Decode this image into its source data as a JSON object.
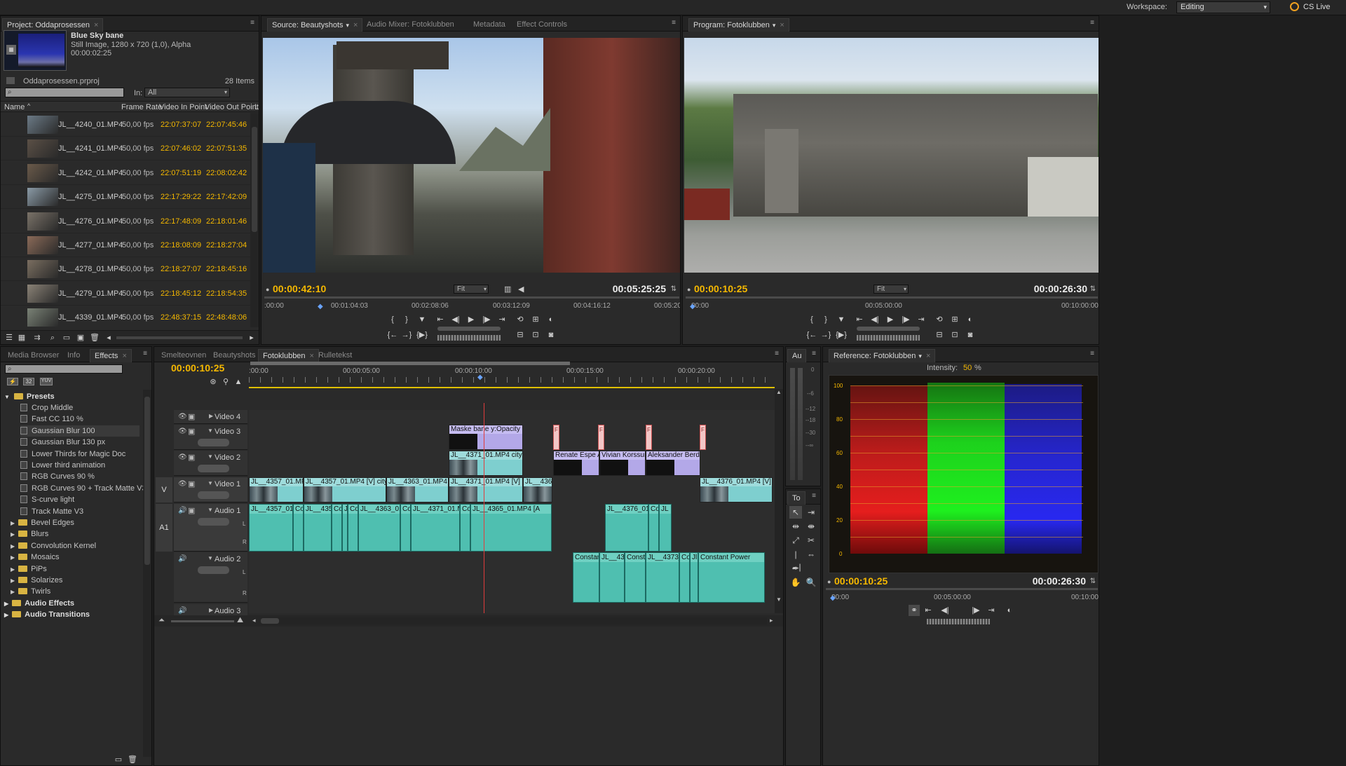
{
  "workspace": {
    "label": "Workspace:",
    "value": "Editing",
    "cslive": "CS Live"
  },
  "project": {
    "tab": "Project: Oddaprosessen",
    "preview_title": "Blue Sky bane",
    "preview_type": "Still Image, 1280 x 720 (1,0), Alpha",
    "preview_duration": "00:00:02:25",
    "file": "Oddaprosessen.prproj",
    "items_count": "28 Items",
    "in_label": "In:",
    "in_value": "All",
    "columns": [
      "Name",
      "Frame Rate",
      "Video In Point",
      "Video Out Point",
      "L"
    ],
    "rows": [
      {
        "name": "JL__4240_01.MP4",
        "fps": "50,00 fps",
        "in": "22:07:37:07",
        "out": "22:07:45:46"
      },
      {
        "name": "JL__4241_01.MP4",
        "fps": "50,00 fps",
        "in": "22:07:46:02",
        "out": "22:07:51:35"
      },
      {
        "name": "JL__4242_01.MP4",
        "fps": "50,00 fps",
        "in": "22:07:51:19",
        "out": "22:08:02:42"
      },
      {
        "name": "JL__4275_01.MP4",
        "fps": "50,00 fps",
        "in": "22:17:29:22",
        "out": "22:17:42:09"
      },
      {
        "name": "JL__4276_01.MP4",
        "fps": "50,00 fps",
        "in": "22:17:48:09",
        "out": "22:18:01:46"
      },
      {
        "name": "JL__4277_01.MP4",
        "fps": "50,00 fps",
        "in": "22:18:08:09",
        "out": "22:18:27:04"
      },
      {
        "name": "JL__4278_01.MP4",
        "fps": "50,00 fps",
        "in": "22:18:27:07",
        "out": "22:18:45:16"
      },
      {
        "name": "JL__4279_01.MP4",
        "fps": "50,00 fps",
        "in": "22:18:45:12",
        "out": "22:18:54:35"
      },
      {
        "name": "JL__4339_01.MP4",
        "fps": "50,00 fps",
        "in": "22:48:37:15",
        "out": "22:48:48:06"
      }
    ]
  },
  "source": {
    "tabs": [
      "Source: Beautyshots",
      "Audio Mixer: Fotoklubben",
      "Metadata",
      "Effect Controls"
    ],
    "timecode": "00:00:42:10",
    "fit": "Fit",
    "duration": "00:05:25:25",
    "ruler": [
      ":00:00",
      "00:01:04:03",
      "00:02:08:06",
      "00:03:12:09",
      "00:04:16:12",
      "00:05:20"
    ]
  },
  "program": {
    "tab": "Program: Fotoklubben",
    "timecode": "00:00:10:25",
    "fit": "Fit",
    "duration": "00:00:26:30",
    "ruler": [
      "00:00",
      "00:05:00:00",
      "00:10:00:00"
    ]
  },
  "effects": {
    "tabs": [
      "Media Browser",
      "Info",
      "Effects"
    ],
    "badges": [
      "32",
      "YUV"
    ],
    "presets_label": "Presets",
    "presets": [
      "Crop Middle",
      "Fast CC 110 %",
      "Gaussian Blur 100",
      "Gaussian Blur 130 px",
      "Lower Thirds for Magic Doc",
      "Lower third animation",
      "RGB Curves 90 %",
      "RGB Curves 90 + Track Matte V3",
      "S-curve light",
      "Track Matte V3"
    ],
    "folders": [
      "Bevel Edges",
      "Blurs",
      "Convolution Kernel",
      "Mosaics",
      "PiPs",
      "Solarizes",
      "Twirls"
    ],
    "root_folders": [
      "Audio Effects",
      "Audio Transitions"
    ]
  },
  "timeline": {
    "tabs": [
      "Smelteovnen",
      "Beautyshots",
      "Fotoklubben",
      "Rulletekst"
    ],
    "timecode": "00:00:10:25",
    "ruler": [
      ":00:00",
      "00:00:05:00",
      "00:00:10:00",
      "00:00:15:00",
      "00:00:20:00"
    ],
    "tracks": {
      "v4": "Video 4",
      "v3": "Video 3",
      "v2": "Video 2",
      "v1": "Video 1",
      "a1": "Audio 1",
      "a2": "Audio 2",
      "a3": "Audio 3"
    },
    "side_v": "V",
    "side_a1": "A1",
    "v3_clips": [
      "Maske bane",
      "y:Opacity"
    ],
    "v2_clips": [
      "JL__4371_01.MP4",
      "city",
      "Renate Espe A",
      "Vivian Korssun",
      "Aleksander Berda"
    ],
    "v1_clips": [
      "JL__4357_01.MP4",
      "JL__4357_01.MP4 [V]",
      "city",
      "JL__4363_01.MP4 [V]",
      "JL__4371_01.MP4 [V]",
      "JL__4365",
      "JL__4376_01.MP4 [V]"
    ],
    "a1_clips": [
      "JL__4357_01.l",
      "Consta",
      "JL__4357_",
      "Consta",
      "JL",
      "Consta",
      "JL__4363_01",
      "Consta",
      "JL__4371_01.MP4",
      "Consta",
      "JL__4365_01.MP4 [A",
      "JL__4376_01.MP4",
      "Consta",
      "JL"
    ],
    "a2_clips": [
      "Constan",
      "JL__43",
      "Consta",
      "JL__4373_0",
      "Consta",
      "Jl",
      "Constant Power"
    ],
    "lr": [
      "L",
      "R"
    ],
    "marker_letter": "F"
  },
  "audiometer": {
    "label": "Au",
    "ticks": [
      "0",
      "--6",
      "--12",
      "--18",
      "--30",
      "--∞"
    ]
  },
  "tools": {
    "label": "To"
  },
  "reference": {
    "tab": "Reference: Fotoklubben",
    "intensity_label": "Intensity:",
    "intensity_value": "50",
    "intensity_unit": "%",
    "scale": [
      "100",
      "80",
      "60",
      "40",
      "20",
      "0"
    ],
    "timecode": "00:00:10:25",
    "duration": "00:00:26:30",
    "ruler": [
      "00:00",
      "00:05:00:00",
      "00:10:00"
    ]
  }
}
